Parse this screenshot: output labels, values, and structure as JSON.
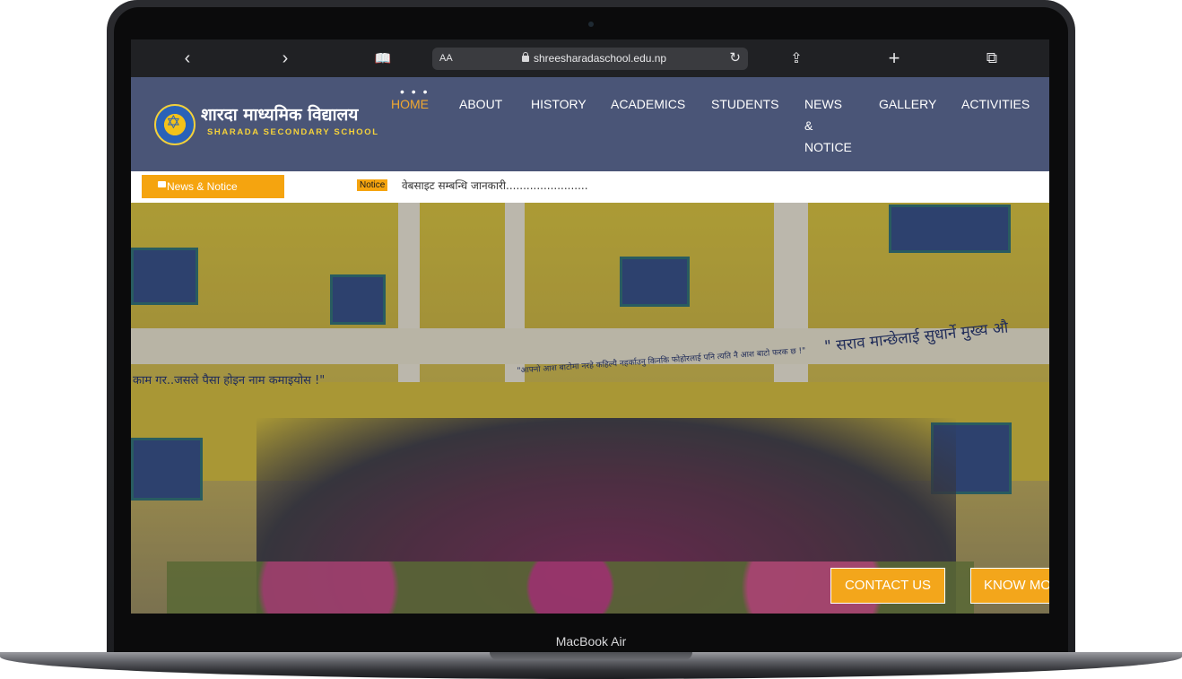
{
  "device": {
    "label": "MacBook Air"
  },
  "browser": {
    "text_size_label": "AA",
    "url": "shreesharadaschool.edu.np",
    "icons": [
      "back-icon",
      "forward-icon",
      "bookmarks-icon",
      "lock-icon",
      "reload-icon",
      "share-icon",
      "new-tab-icon",
      "tabs-icon"
    ],
    "glyphs": {
      "back": "‹",
      "forward": "›",
      "bookmarks": "📖",
      "reload": "↻",
      "share": "⇪",
      "new_tab": "+",
      "tabs": "⧉"
    }
  },
  "site": {
    "logo": {
      "devanagari": "शारदा माध्यमिक विद्यालय",
      "english": "SHARADA SECONDARY SCHOOL"
    },
    "nav": {
      "dots": "• • •",
      "items": [
        {
          "label": "HOME",
          "active": true
        },
        {
          "label": "ABOUT"
        },
        {
          "label": "HISTORY"
        },
        {
          "label": "ACADEMICS"
        },
        {
          "label": "STUDENTS"
        },
        {
          "label_lines": [
            "NEWS",
            "&",
            "NOTICE"
          ]
        },
        {
          "label": "GALLERY"
        },
        {
          "label": "ACTIVITIES"
        }
      ]
    },
    "ticker": {
      "tag": "News & Notice",
      "badge": "Notice",
      "text": "वेबसाइट सम्बन्धि जानकारी........................"
    },
    "hero": {
      "slogan_left": "काम गर..जसले पैसा होइन नाम कमाइयोस !\"",
      "slogan_center": "\"आफ्नो आश बाटोमा नरहे कहिल्यै नहर्काउनु किनकि फोहोरलाई पनि त्यति नै आश बाटो फरक छ !\"",
      "slogan_right": "\" सराव मान्छेलाई सुधार्ने मुख्य औ",
      "cta_contact": "CONTACT US",
      "cta_know": "KNOW MORE"
    }
  },
  "colors": {
    "header_bg": "#4a5577",
    "accent": "#f5a40f",
    "active_nav": "#f0a830"
  }
}
